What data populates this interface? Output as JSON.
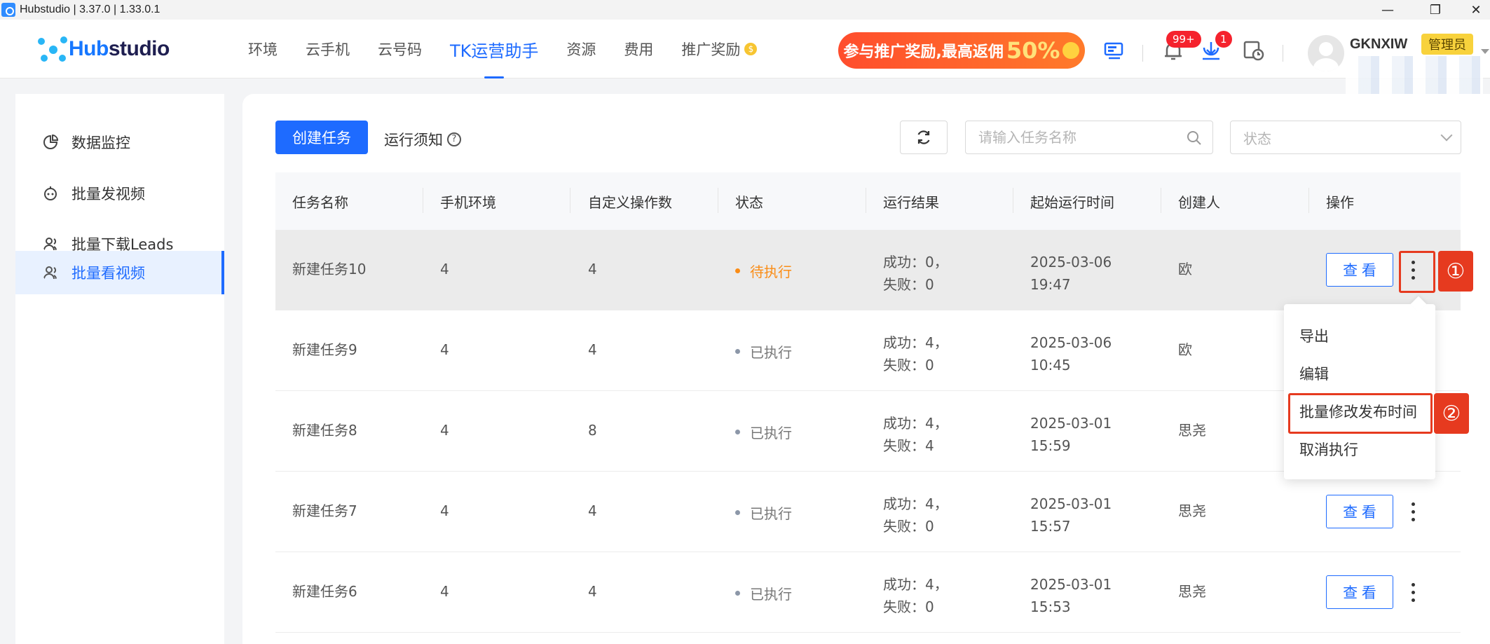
{
  "window": {
    "title": "Hubstudio | 3.37.0 | 1.33.0.1",
    "controls": [
      "—",
      "❐",
      "✕"
    ]
  },
  "header": {
    "logo_prefix": "Hub",
    "logo_suffix": "studio",
    "nav": [
      {
        "label": "环境"
      },
      {
        "label": "云手机"
      },
      {
        "label": "云号码"
      },
      {
        "label": "TK运营助手",
        "active": true
      },
      {
        "label": "资源"
      },
      {
        "label": "费用"
      },
      {
        "label": "推广奖励"
      }
    ],
    "promo_text": "参与推广奖励,最高返佣",
    "promo_percent": "50%",
    "notification_badge": "99+",
    "download_badge": "1",
    "username": "GKNXIW",
    "role": "管理员"
  },
  "sidebar": {
    "items": [
      {
        "label": "数据监控",
        "icon": "chart-pie-icon"
      },
      {
        "label": "批量发视频",
        "icon": "robot-icon"
      },
      {
        "label": "批量下载Leads",
        "icon": "user-icon"
      },
      {
        "label": "批量看视频",
        "icon": "user-icon",
        "active": true
      }
    ]
  },
  "toolbar": {
    "create_label": "创建任务",
    "notice_label": "运行须知",
    "search_placeholder": "请输入任务名称",
    "status_placeholder": "状态"
  },
  "table": {
    "columns": [
      "任务名称",
      "手机环境",
      "自定义操作数",
      "状态",
      "运行结果",
      "起始运行时间",
      "创建人",
      "操作"
    ],
    "rows": [
      {
        "name": "新建任务10",
        "phone_env": "4",
        "ops": "4",
        "status": "待执行",
        "status_color": "#fa8c16",
        "success": "成功：0，",
        "fail": "失败：0",
        "date": "2025-03-06",
        "time": "19:47",
        "creator": "欧"
      },
      {
        "name": "新建任务9",
        "phone_env": "4",
        "ops": "4",
        "status": "已执行",
        "status_color": "#8c97a8",
        "success": "成功：4，",
        "fail": "失败：0",
        "date": "2025-03-06",
        "time": "10:45",
        "creator": "欧"
      },
      {
        "name": "新建任务8",
        "phone_env": "4",
        "ops": "8",
        "status": "已执行",
        "status_color": "#8c97a8",
        "success": "成功：4，",
        "fail": "失败：4",
        "date": "2025-03-01",
        "time": "15:59",
        "creator": "思尧"
      },
      {
        "name": "新建任务7",
        "phone_env": "4",
        "ops": "4",
        "status": "已执行",
        "status_color": "#8c97a8",
        "success": "成功：4，",
        "fail": "失败：0",
        "date": "2025-03-01",
        "time": "15:57",
        "creator": "思尧"
      },
      {
        "name": "新建任务6",
        "phone_env": "4",
        "ops": "4",
        "status": "已执行",
        "status_color": "#8c97a8",
        "success": "成功：4，",
        "fail": "失败：0",
        "date": "2025-03-01",
        "time": "15:53",
        "creator": "思尧"
      }
    ],
    "view_label": "查 看"
  },
  "dropdown": {
    "items": [
      "导出",
      "编辑",
      "批量修改发布时间",
      "取消执行"
    ]
  },
  "annotations": {
    "step1": "①",
    "step2": "②"
  },
  "colors": {
    "accent": "#1e6bff",
    "annotation": "#e63a1f",
    "pending": "#fa8c16"
  }
}
